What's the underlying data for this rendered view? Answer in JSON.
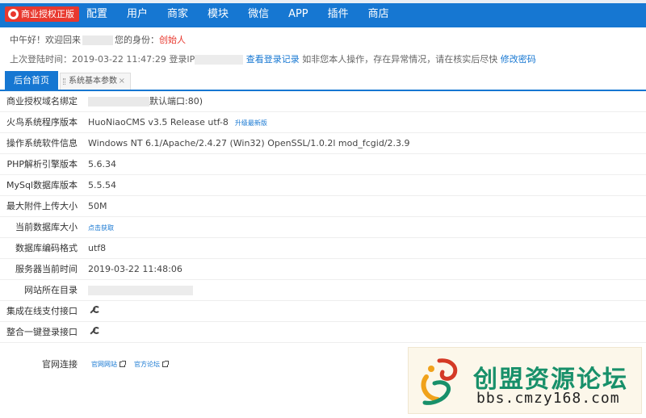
{
  "header": {
    "badge": "商业授权正版",
    "nav": [
      "配置",
      "用户",
      "商家",
      "模块",
      "微信",
      "APP",
      "插件",
      "商店"
    ]
  },
  "greeting": {
    "prefix": "中午好！欢迎回来",
    "role_label": "您的身份：",
    "role": "创始人"
  },
  "last_login": {
    "label": "上次登陆时间：2019-03-22 11:47:29  登录IP",
    "view_records": "查看登录记录",
    "warning": "如非您本人操作，存在异常情况，请在核实后尽快",
    "change_password": "修改密码"
  },
  "tabs": {
    "home": "后台首页",
    "sys": "系统基本参数",
    "close": "×"
  },
  "rows": [
    {
      "label": "商业授权域名绑定",
      "value": "默认端口:80)"
    },
    {
      "label": "火鸟系统程序版本",
      "value": "HuoNiaoCMS v3.5 Release utf-8",
      "link": "升级最新版"
    },
    {
      "label": "操作系统软件信息",
      "value": "Windows NT 6.1/Apache/2.4.27 (Win32) OpenSSL/1.0.2l mod_fcgid/2.3.9"
    },
    {
      "label": "PHP解析引擎版本",
      "value": "5.6.34"
    },
    {
      "label": "MySql数据库版本",
      "value": "5.5.54"
    },
    {
      "label": "最大附件上传大小",
      "value": "50M"
    },
    {
      "label": "当前数据库大小",
      "link": "点击获取"
    },
    {
      "label": "数据库编码格式",
      "value": "utf8"
    },
    {
      "label": "服务器当前时间",
      "value": "2019-03-22 11:48:06"
    },
    {
      "label": "网站所在目录"
    },
    {
      "label": "集成在线支付接口"
    },
    {
      "label": "整合一键登录接口"
    }
  ],
  "official": {
    "label": "官网连接",
    "site": "官网网站",
    "forum": "官方论坛"
  },
  "watermark": {
    "title": "创盟资源论坛",
    "url": "bbs.cmzy168.com"
  },
  "icons": {
    "config": "wrench-icon",
    "external": "external-link-icon",
    "badge": "seal-icon"
  },
  "colors": {
    "primary": "#1677d2",
    "badge": "#e8382e",
    "watermark": "#18906a"
  }
}
